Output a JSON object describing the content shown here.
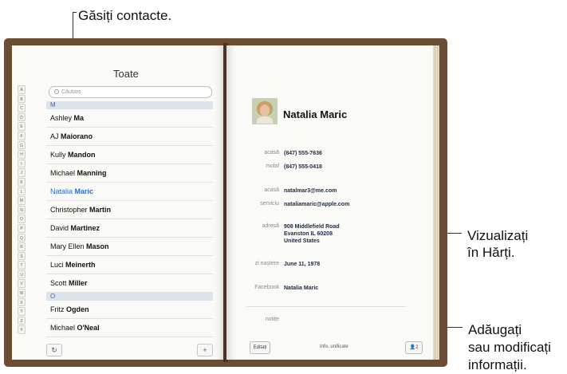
{
  "callouts": {
    "find": "Găsiți contacte.",
    "maps_1": "Vizualizați",
    "maps_2": "în Hărți.",
    "edit_1": "Adăugați",
    "edit_2": "sau modificați",
    "edit_3": "informații."
  },
  "list": {
    "title": "Toate",
    "search_placeholder": "Căutare",
    "alphabet": [
      "A",
      "B",
      "C",
      "D",
      "E",
      "F",
      "G",
      "H",
      "I",
      "J",
      "K",
      "L",
      "M",
      "N",
      "O",
      "P",
      "Q",
      "R",
      "S",
      "T",
      "U",
      "V",
      "W",
      "X",
      "Y",
      "Z",
      "#"
    ],
    "sections": [
      {
        "letter": "M",
        "rows": [
          {
            "first": "Ashley",
            "last": "Ma"
          },
          {
            "first": "AJ",
            "last": "Maiorano"
          },
          {
            "first": "Kully",
            "last": "Mandon"
          },
          {
            "first": "Michael",
            "last": "Manning"
          },
          {
            "first": "Natalia",
            "last": "Maric",
            "selected": true
          },
          {
            "first": "Christopher",
            "last": "Martin"
          },
          {
            "first": "David",
            "last": "Martinez"
          },
          {
            "first": "Mary Ellen",
            "last": "Mason"
          },
          {
            "first": "Luci",
            "last": "Meinerth"
          },
          {
            "first": "Scott",
            "last": "Miller"
          }
        ]
      },
      {
        "letter": "O",
        "rows": [
          {
            "first": "Fritz",
            "last": "Ogden"
          },
          {
            "first": "Michael",
            "last": "O'Neal"
          }
        ]
      }
    ],
    "refresh_icon": "↻",
    "add_icon": "+"
  },
  "contact": {
    "name": "Natalia Maric",
    "fields": {
      "home_phone_label": "acasă",
      "home_phone": "(847) 555-7636",
      "mobile_label": "mobil",
      "mobile": "(847) 555-0418",
      "home_email_label": "acasă",
      "home_email": "natalmar3@me.com",
      "work_email_label": "serviciu",
      "work_email": "nataliamaric@apple.com",
      "address_label": "adresă",
      "address_1": "908 Middlefield Road",
      "address_2": "Evanston IL 60208",
      "address_3": "United States",
      "birthday_label": "zi naștere",
      "birthday": "June 11, 1978",
      "facebook_label": "Facebook",
      "facebook": "Natalia Maric",
      "notes_label": "notițe"
    },
    "edit_button": "Editați",
    "unified_info": "Info. unificate",
    "linked_count": "👤2"
  }
}
